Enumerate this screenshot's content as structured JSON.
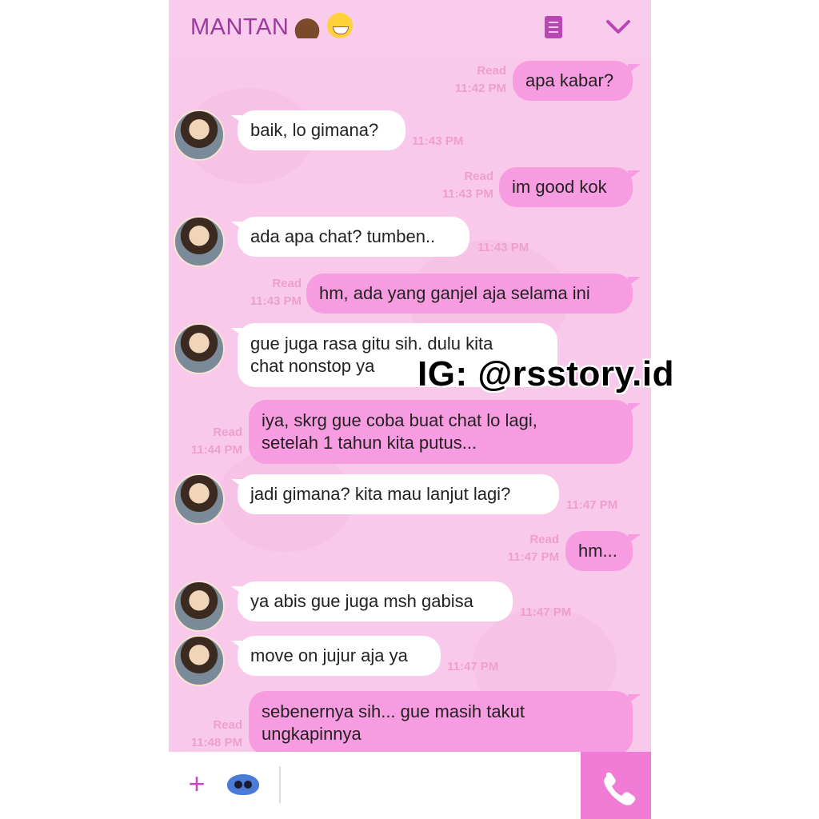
{
  "header": {
    "title": "MANTAN"
  },
  "colors": {
    "accent": "#c34ac0",
    "bubble_out": "#f79ce0",
    "bubble_in": "#ffffff",
    "bg": "#f9c9ec",
    "meta": "#ee9fcc"
  },
  "messages": [
    {
      "dir": "out",
      "text": "apa kabar?",
      "read": "Read",
      "time": "11:42 PM"
    },
    {
      "dir": "in",
      "text": "baik, lo gimana?",
      "time": "11:43 PM"
    },
    {
      "dir": "out",
      "text": "im good kok",
      "read": "Read",
      "time": "11:43 PM"
    },
    {
      "dir": "in",
      "text": "ada apa chat? tumben..",
      "time": "11:43 PM"
    },
    {
      "dir": "out",
      "text": "hm, ada yang ganjel aja selama ini",
      "read": "Read",
      "time": "11:43 PM"
    },
    {
      "dir": "in",
      "line1": "gue juga rasa gitu sih. dulu kita",
      "line2": "chat nonstop ya"
    },
    {
      "dir": "out",
      "line1": "iya, skrg gue coba buat chat lo lagi,",
      "line2": "setelah 1 tahun kita putus...",
      "read": "Read",
      "time": "11:44 PM"
    },
    {
      "dir": "in",
      "text": "jadi gimana? kita mau lanjut lagi?",
      "time": "11:47 PM"
    },
    {
      "dir": "out",
      "text": "hm...",
      "read": "Read",
      "time": "11:47 PM"
    },
    {
      "dir": "in",
      "text": "ya abis gue juga msh gabisa",
      "time": "11:47 PM"
    },
    {
      "dir": "in",
      "text": "move on jujur aja ya",
      "time": "11:47 PM"
    },
    {
      "dir": "out",
      "line1": "sebenernya sih... gue masih takut",
      "line2": "ungkapinnya",
      "read": "Read",
      "time": "11:48 PM"
    }
  ],
  "watermark": "IG: @rsstory.id",
  "icons": {
    "menu": "menu-icon",
    "collapse": "chevron-down-icon",
    "add": "plus-icon",
    "sticker": "sticker-icon",
    "call": "phone-icon"
  }
}
